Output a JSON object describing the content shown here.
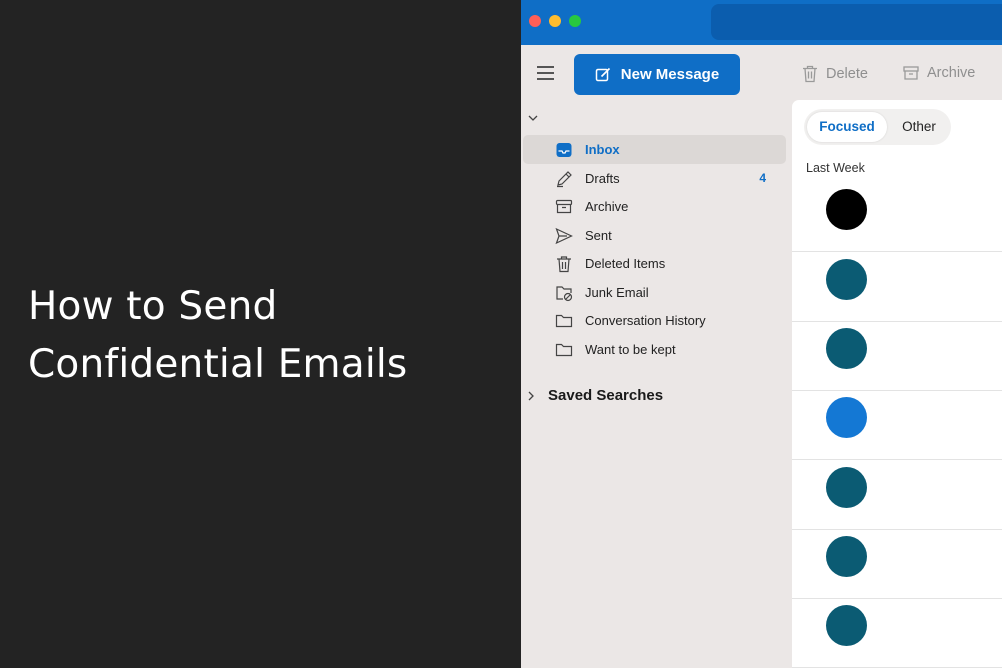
{
  "headline": {
    "line1": "How to Send",
    "line2": "Confidential Emails"
  },
  "toolbar": {
    "new_message_label": "New Message",
    "delete_label": "Delete",
    "archive_label": "Archive"
  },
  "folders": [
    {
      "label": "Inbox",
      "icon": "inbox-icon",
      "count": ""
    },
    {
      "label": "Drafts",
      "icon": "drafts-icon",
      "count": "4"
    },
    {
      "label": "Archive",
      "icon": "archive-icon",
      "count": ""
    },
    {
      "label": "Sent",
      "icon": "sent-icon",
      "count": ""
    },
    {
      "label": "Deleted Items",
      "icon": "trash-icon",
      "count": ""
    },
    {
      "label": "Junk Email",
      "icon": "junk-icon",
      "count": ""
    },
    {
      "label": "Conversation History",
      "icon": "folder-icon",
      "count": ""
    },
    {
      "label": "Want to be kept",
      "icon": "folder-icon",
      "count": ""
    }
  ],
  "saved_searches": {
    "label": "Saved Searches"
  },
  "message_list": {
    "tabs": [
      "Focused",
      "Other"
    ],
    "active_tab": "Focused",
    "group_label": "Last Week",
    "avatar_colors": [
      "#000000",
      "#0b5b73",
      "#0b5b73",
      "#1478d4",
      "#0b5b73",
      "#0b5b73",
      "#0b5b73"
    ]
  },
  "colors": {
    "accent": "#0f6ec6",
    "sidebar_bg": "#ebe7e6",
    "left_panel_bg": "#232323"
  }
}
